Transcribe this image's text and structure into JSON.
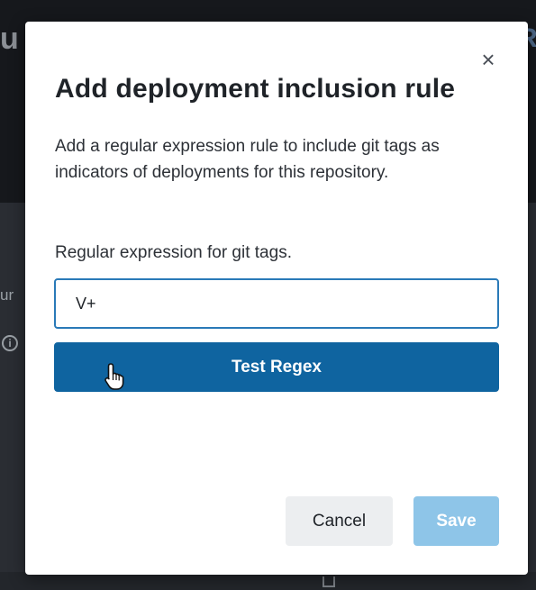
{
  "background": {
    "heading_fragment_left": "u",
    "heading_fragment_right": "R",
    "text_fragment_left": "ur"
  },
  "modal": {
    "close_label": "×",
    "title": "Add deployment inclusion rule",
    "description": "Add a regular expression rule to include git tags as indicators of deployments for this repository.",
    "regex_label": "Regular expression for git tags.",
    "regex_value": "V+",
    "test_button_label": "Test Regex",
    "cancel_label": "Cancel",
    "save_label": "Save"
  },
  "colors": {
    "primary": "#0f64a0",
    "input_focus_border": "#2a7ab8",
    "save_disabled": "#8ec5e8",
    "cancel_bg": "#eceef0"
  },
  "icons": {
    "close": "close-icon",
    "cursor": "hand-pointer-icon",
    "info": "info-icon",
    "trash": "trash-icon"
  }
}
